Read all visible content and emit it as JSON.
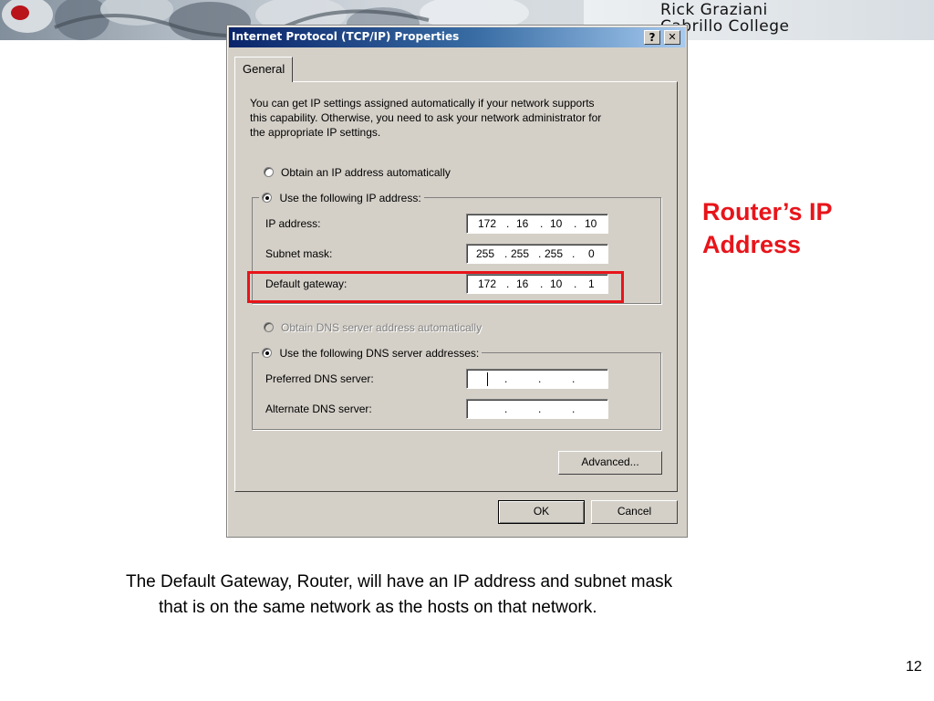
{
  "banner": {
    "line1": "Rick Graziani",
    "line2": "Cabrillo College"
  },
  "dialog": {
    "title": "Internet Protocol (TCP/IP) Properties",
    "help_button": "?",
    "close_button": "✕",
    "tab_label": "General",
    "description_lines": [
      "You can get IP settings assigned automatically if your network supports",
      "this capability. Otherwise, you need to ask your network administrator for",
      "the appropriate IP settings."
    ],
    "ip_section": {
      "obtain_auto_label": "Obtain an IP address automatically",
      "use_following_label": "Use the following IP address:",
      "ip_address_label": "IP address:",
      "ip_address_octets": [
        "172",
        "16",
        "10",
        "10"
      ],
      "subnet_mask_label": "Subnet mask:",
      "subnet_mask_octets": [
        "255",
        "255",
        "255",
        "0"
      ],
      "default_gateway_label": "Default gateway:",
      "default_gateway_octets": [
        "172",
        "16",
        "10",
        "1"
      ]
    },
    "dns_section": {
      "obtain_auto_label": "Obtain DNS server address automatically",
      "use_following_label": "Use the following DNS server addresses:",
      "preferred_label": "Preferred DNS server:",
      "alternate_label": "Alternate DNS server:",
      "dot": "."
    },
    "advanced_button": "Advanced...",
    "ok_button": "OK",
    "cancel_button": "Cancel"
  },
  "callout": {
    "line1": "Router’s IP",
    "line2": "Address",
    "color": "#e8141a"
  },
  "caption": {
    "line1": "The Default Gateway, Router, will have an IP address and subnet mask",
    "line2": "that is on the same network as the hosts on that network."
  },
  "page_number": "12"
}
